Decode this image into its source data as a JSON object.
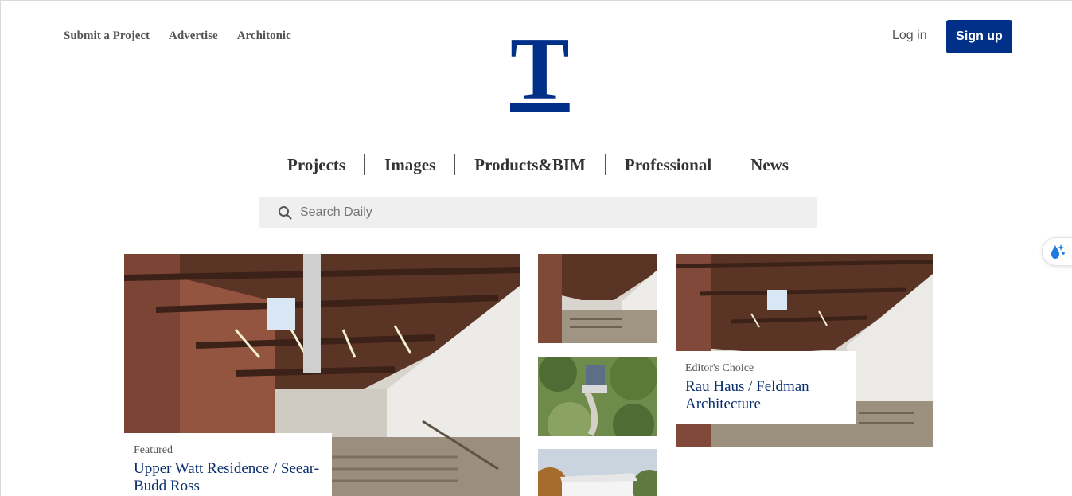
{
  "header": {
    "top_links": [
      "Submit a Project",
      "Advertise",
      "Architonic"
    ],
    "logo_text": "T",
    "login_label": "Log in",
    "signup_label": "Sign up"
  },
  "nav": {
    "items": [
      "Projects",
      "Images",
      "Products&BIM",
      "Professional",
      "News"
    ]
  },
  "search": {
    "placeholder": "Search Daily"
  },
  "featured": {
    "tag": "Featured",
    "title": "Upper Watt Residence / Seear-Budd Ross"
  },
  "editors_choice": {
    "tag": "Editor's Choice",
    "title": "Rau Haus / Feldman Architecture"
  },
  "icons": {
    "search": "search-icon",
    "side_widget": "water-drop-sparkle-icon"
  },
  "colors": {
    "brand": "#003087",
    "title_link": "#0a2f6e",
    "muted_text": "#555555",
    "search_background": "#efefef"
  }
}
